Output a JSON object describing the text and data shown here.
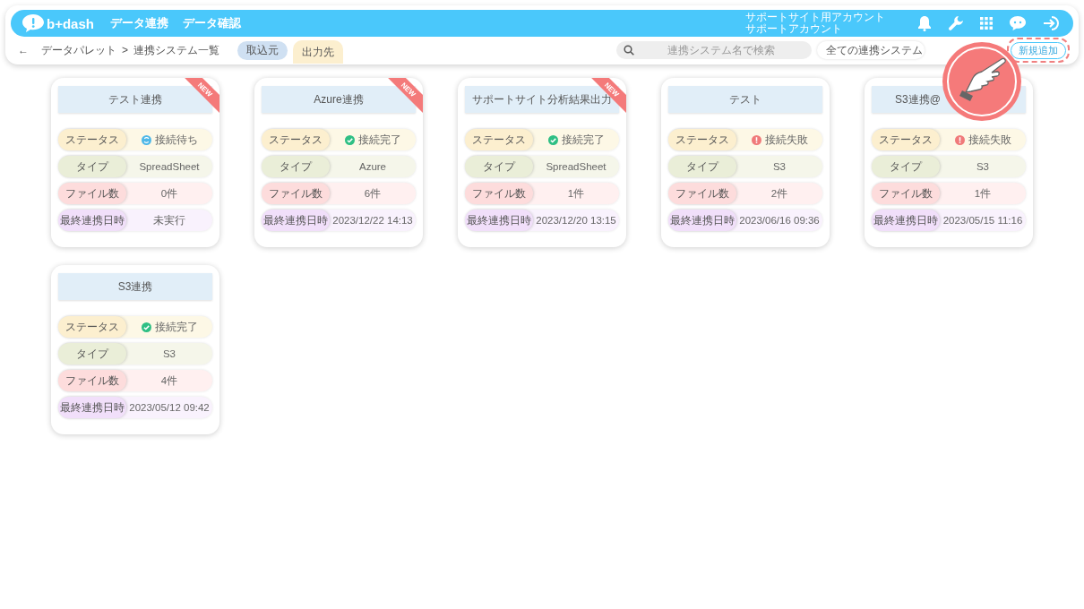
{
  "header": {
    "logo": "b+dash",
    "nav": [
      "データ連携",
      "データ確認"
    ],
    "account": [
      "サポートサイト用アカウント",
      "サポートアカウント"
    ]
  },
  "breadcrumb": {
    "back": "←",
    "items": [
      "データパレット",
      ">",
      "連携システム一覧"
    ]
  },
  "tabs": [
    {
      "label": "取込元",
      "selected": false
    },
    {
      "label": "出力先",
      "selected": true
    }
  ],
  "search": {
    "placeholder": "連携システム名で検索"
  },
  "filter": {
    "value": "全ての連携システム"
  },
  "add_button": "新規追加",
  "cards": [
    {
      "title": "テスト連携",
      "badge": "NEW",
      "title_cut": false,
      "rows": [
        {
          "kind": "status",
          "label": "ステータス",
          "value": "接続待ち",
          "icon": {
            "kind": "waiting",
            "color": "#4fb8e8"
          }
        },
        {
          "kind": "type",
          "label": "タイプ",
          "value": "SpreadSheet"
        },
        {
          "kind": "files",
          "label": "ファイル数",
          "value": "0件"
        },
        {
          "kind": "date",
          "label": "最終連携日時",
          "value": "未実行"
        }
      ]
    },
    {
      "title": "Azure連携",
      "badge": "NEW",
      "title_cut": false,
      "rows": [
        {
          "kind": "status",
          "label": "ステータス",
          "value": "接続完了",
          "icon": {
            "kind": "done",
            "color": "#2fbf84"
          }
        },
        {
          "kind": "type",
          "label": "タイプ",
          "value": "Azure"
        },
        {
          "kind": "files",
          "label": "ファイル数",
          "value": "6件"
        },
        {
          "kind": "date",
          "label": "最終連携日時",
          "value": "2023/12/22 14:13"
        }
      ]
    },
    {
      "title": "サポートサイト分析結果出力",
      "badge": "NEW",
      "title_cut": false,
      "rows": [
        {
          "kind": "status",
          "label": "ステータス",
          "value": "接続完了",
          "icon": {
            "kind": "done",
            "color": "#2fbf84"
          }
        },
        {
          "kind": "type",
          "label": "タイプ",
          "value": "SpreadSheet"
        },
        {
          "kind": "files",
          "label": "ファイル数",
          "value": "1件"
        },
        {
          "kind": "date",
          "label": "最終連携日時",
          "value": "2023/12/20 13:15"
        }
      ]
    },
    {
      "title": "テスト",
      "title_cut": false,
      "rows": [
        {
          "kind": "status",
          "label": "ステータス",
          "value": "接続失敗",
          "icon": {
            "kind": "failed",
            "color": "#f07a7a"
          }
        },
        {
          "kind": "type",
          "label": "タイプ",
          "value": "S3"
        },
        {
          "kind": "files",
          "label": "ファイル数",
          "value": "2件"
        },
        {
          "kind": "date",
          "label": "最終連携日時",
          "value": "2023/06/16 09:36"
        }
      ]
    },
    {
      "title": "S3連携@",
      "title_cut": true,
      "rows": [
        {
          "kind": "status",
          "label": "ステータス",
          "value": "接続失敗",
          "icon": {
            "kind": "failed",
            "color": "#f07a7a"
          }
        },
        {
          "kind": "type",
          "label": "タイプ",
          "value": "S3"
        },
        {
          "kind": "files",
          "label": "ファイル数",
          "value": "1件"
        },
        {
          "kind": "date",
          "label": "最終連携日時",
          "value": "2023/05/15 11:16"
        }
      ]
    },
    {
      "title": "S3連携",
      "title_cut": false,
      "rows": [
        {
          "kind": "status",
          "label": "ステータス",
          "value": "接続完了",
          "icon": {
            "kind": "done",
            "color": "#2fbf84"
          }
        },
        {
          "kind": "type",
          "label": "タイプ",
          "value": "S3"
        },
        {
          "kind": "files",
          "label": "ファイル数",
          "value": "4件"
        },
        {
          "kind": "date",
          "label": "最終連携日時",
          "value": "2023/05/12 09:42"
        }
      ]
    }
  ]
}
